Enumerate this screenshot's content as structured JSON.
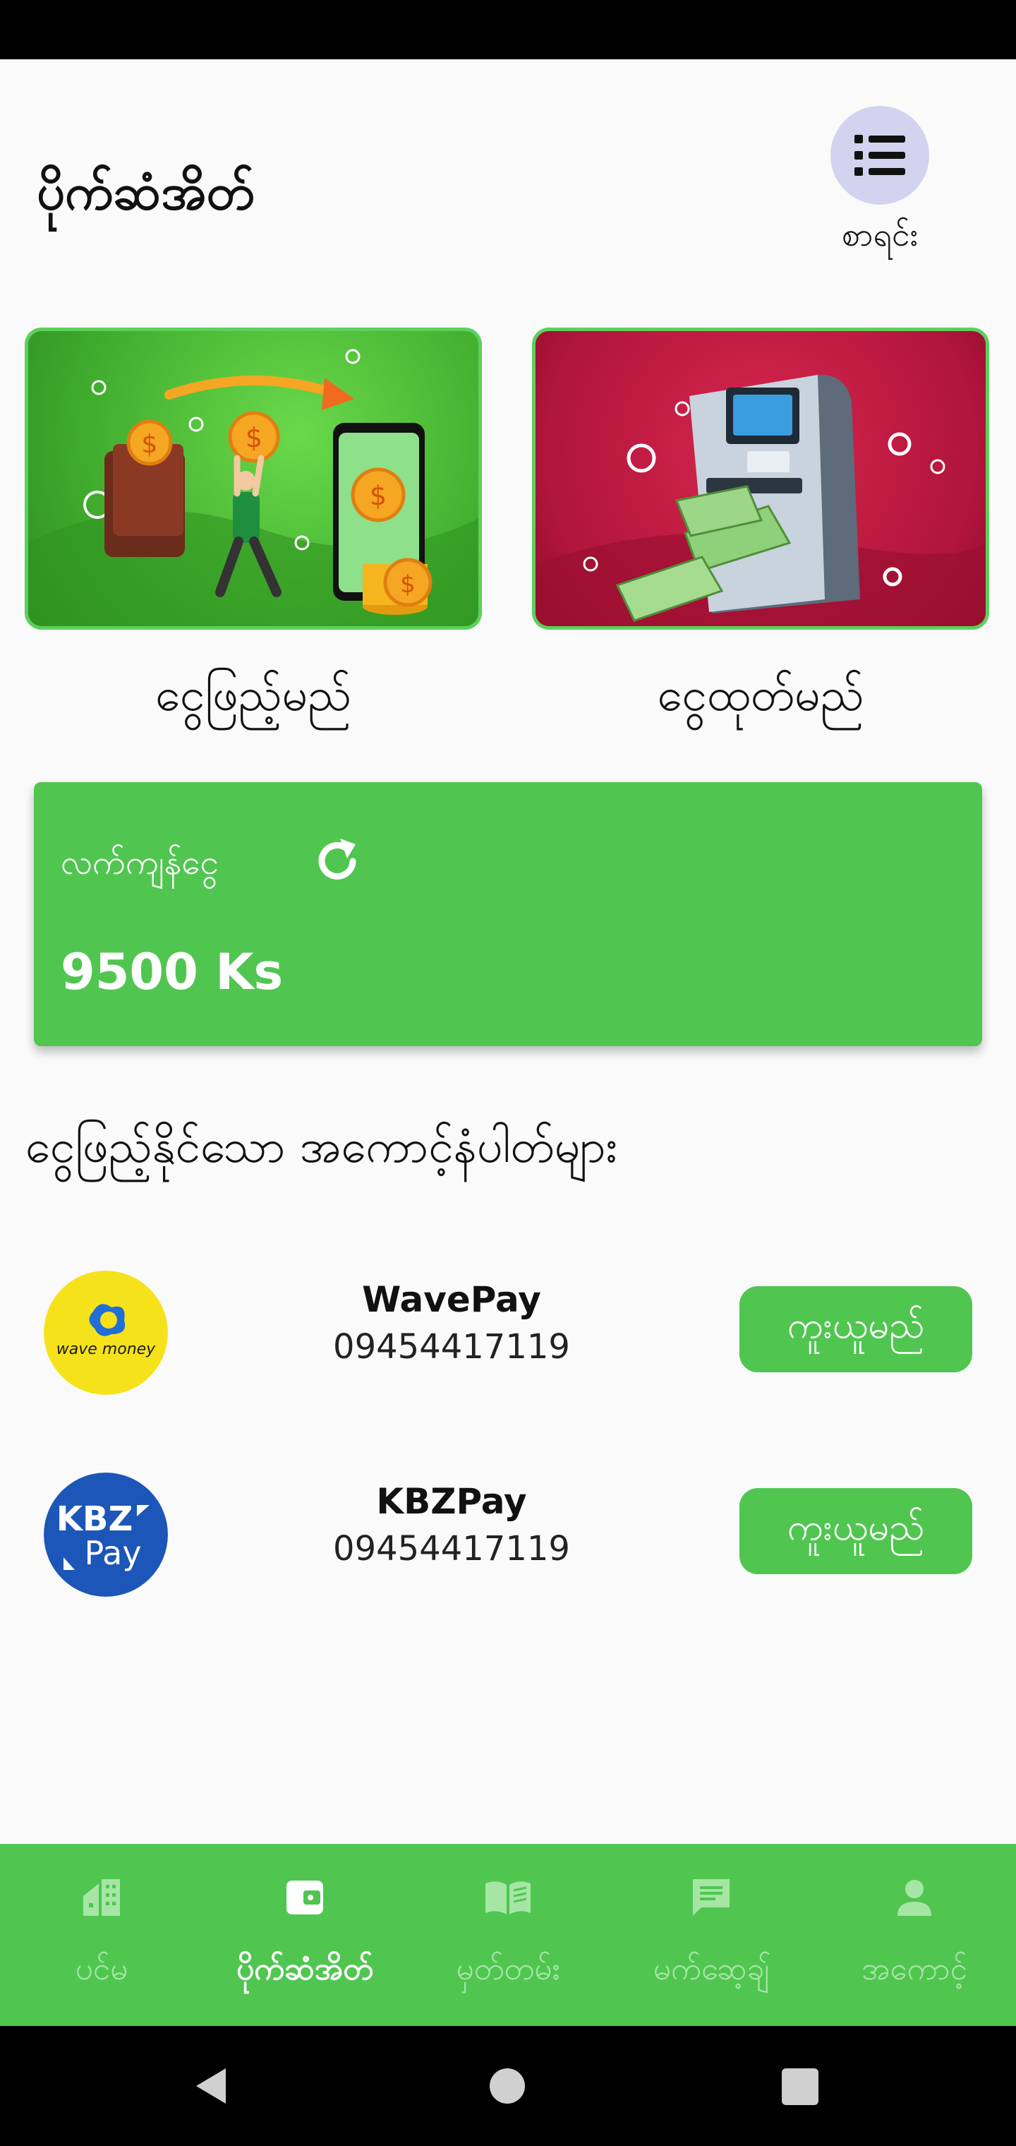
{
  "header": {
    "title": "ပိုက်ဆံအိတ်",
    "list_label": "စာရင်း"
  },
  "actions": {
    "deposit_label": "ငွေဖြည့်မည်",
    "withdraw_label": "ငွေထုတ်မည်"
  },
  "balance": {
    "label": "လက်ကျန်ငွေ",
    "amount": "9500 Ks"
  },
  "section_title": "ငွေဖြည့်နိုင်သော အကောင့်နံပါတ်များ",
  "accounts": [
    {
      "name": "WavePay",
      "phone": "09454417119",
      "copy_label": "ကူးယူမည်",
      "logo_text": "wave money"
    },
    {
      "name": "KBZPay",
      "phone": "09454417119",
      "copy_label": "ကူးယူမည်",
      "logo_text_top": "KBZ",
      "logo_text_bottom": "Pay"
    }
  ],
  "nav": [
    {
      "label": "ပင်မ",
      "icon": "home-icon"
    },
    {
      "label": "ပိုက်ဆံအိတ်",
      "icon": "wallet-icon",
      "active": true
    },
    {
      "label": "မှတ်တမ်း",
      "icon": "book-icon"
    },
    {
      "label": "မက်ဆေ့ချ်",
      "icon": "message-icon"
    },
    {
      "label": "အကောင့်",
      "icon": "person-icon"
    }
  ],
  "colors": {
    "primary": "#50c650",
    "deposit_bg": "#3da82c",
    "withdraw_bg": "#b0153a",
    "menu_circle": "#d3d3f0",
    "wave_yellow": "#f6e21a",
    "kbz_blue": "#1b56b8"
  }
}
